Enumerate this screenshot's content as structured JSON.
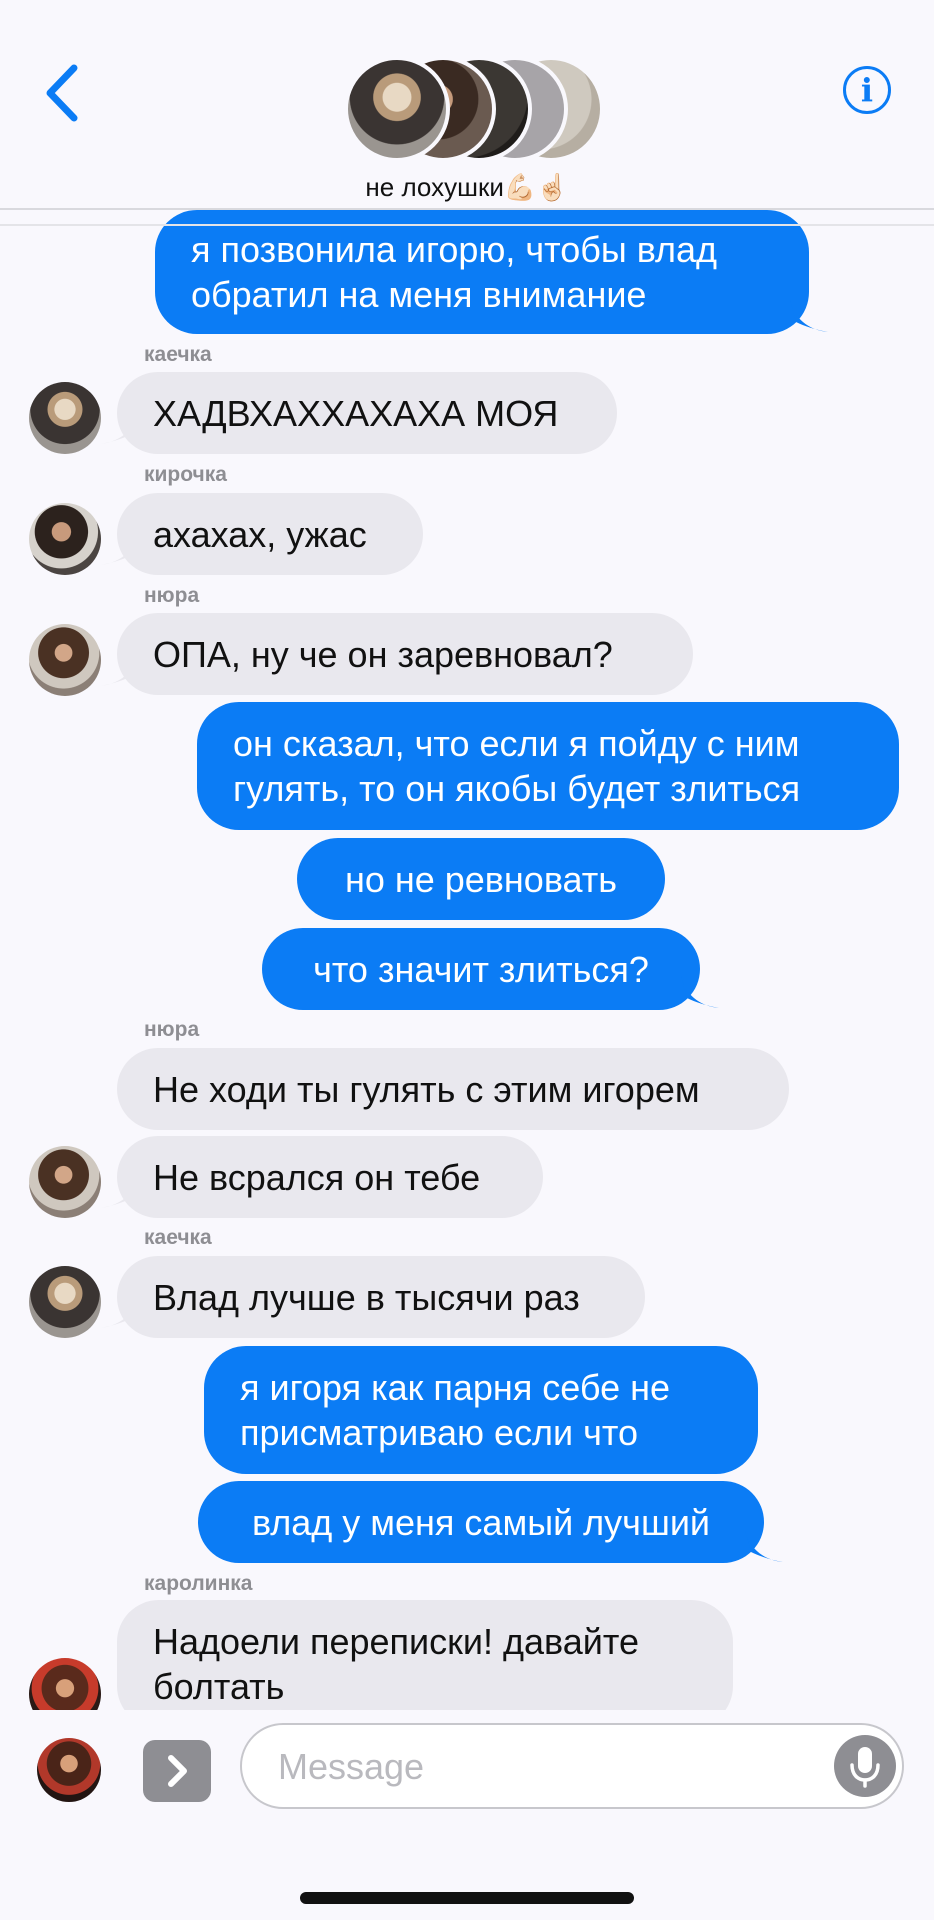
{
  "header": {
    "group_name": "не лохушки💪🏻☝🏻",
    "info_label": "i"
  },
  "messages": [
    {
      "sender": "",
      "direction": "out",
      "text": "я позвонила игорю, чтобы влад обратил на меня внимание"
    },
    {
      "sender": "каечка",
      "direction": "in",
      "text": "ХАДВХАХХАХАХА МОЯ"
    },
    {
      "sender": "кирочка",
      "direction": "in",
      "text": "ахахах, ужас"
    },
    {
      "sender": "нюра",
      "direction": "in",
      "text": "ОПА, ну че он заревновал?"
    },
    {
      "sender": "",
      "direction": "out",
      "text": "он сказал, что если я пойду с ним гулять, то он якобы будет злиться"
    },
    {
      "sender": "",
      "direction": "out",
      "text": "но не ревновать"
    },
    {
      "sender": "",
      "direction": "out",
      "text": "что значит злиться?"
    },
    {
      "sender": "нюра",
      "direction": "in",
      "text": "Не ходи ты гулять с этим игорем"
    },
    {
      "sender": "",
      "direction": "in",
      "text": "Не всрался он тебе"
    },
    {
      "sender": "каечка",
      "direction": "in",
      "text": "Влад лучше в тысячи раз"
    },
    {
      "sender": "",
      "direction": "out",
      "text": "я игоря как парня себе не присматриваю если что"
    },
    {
      "sender": "",
      "direction": "out",
      "text": "влад у меня самый лучший"
    },
    {
      "sender": "каролинка",
      "direction": "in",
      "text": "Надоели переписки! давайте болтать"
    }
  ],
  "composer": {
    "placeholder": "Message"
  },
  "colors": {
    "accent": "#0b7cf5",
    "incoming_bubble": "#e9e8ee",
    "background": "#f9f8fd"
  }
}
